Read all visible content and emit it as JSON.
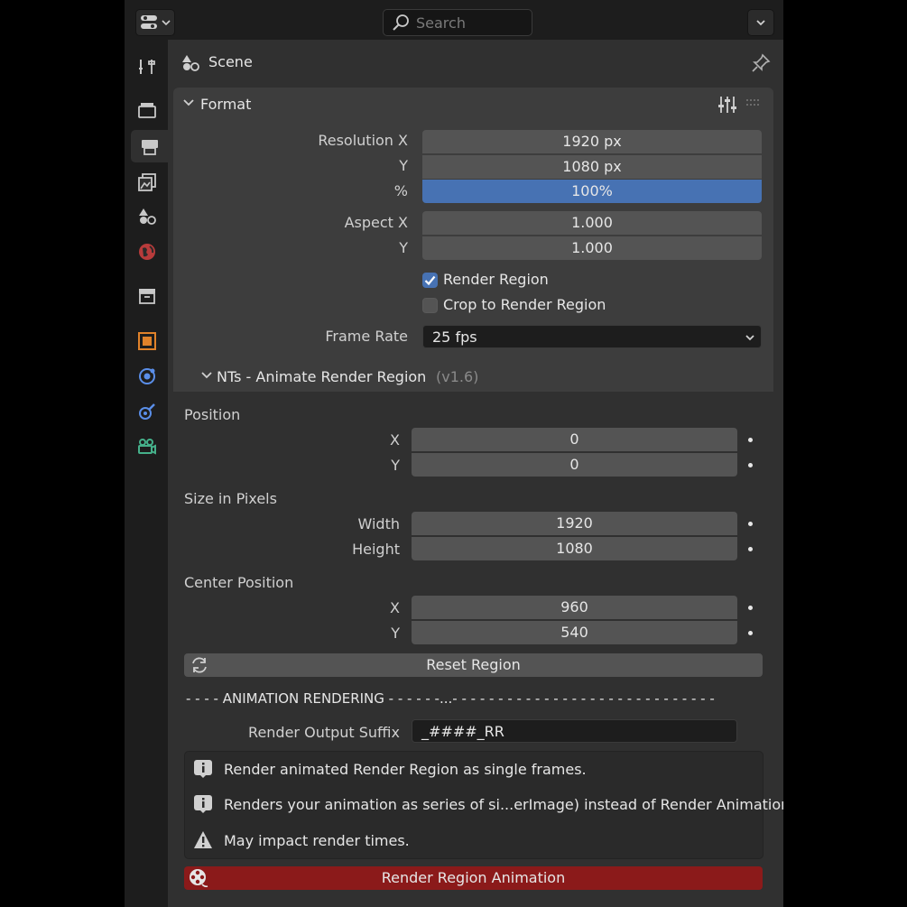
{
  "search": {
    "placeholder": "Search"
  },
  "header": {
    "title": "Scene"
  },
  "tabs": [
    "tool",
    "render",
    "output",
    "view-layer",
    "scene",
    "world",
    "collection",
    "object",
    "physics",
    "constraints",
    "data"
  ],
  "format": {
    "title": "Format",
    "resolution_x_label": "Resolution X",
    "resolution_x": "1920 px",
    "resolution_y_label": "Y",
    "resolution_y": "1080 px",
    "percent_label": "%",
    "percent": "100%",
    "aspect_x_label": "Aspect X",
    "aspect_x": "1.000",
    "aspect_y_label": "Y",
    "aspect_y": "1.000",
    "render_region_label": "Render Region",
    "render_region_checked": true,
    "crop_label": "Crop to Render Region",
    "crop_checked": false,
    "frame_rate_label": "Frame Rate",
    "frame_rate": "25 fps"
  },
  "addon": {
    "title": "NTs - Animate Render Region",
    "version": "(v1.6)",
    "position_label": "Position",
    "pos_x_label": "X",
    "pos_x": "0",
    "pos_y_label": "Y",
    "pos_y": "0",
    "size_label": "Size in Pixels",
    "width_label": "Width",
    "width": "1920",
    "height_label": "Height",
    "height": "1080",
    "center_label": "Center Position",
    "center_x_label": "X",
    "center_x": "960",
    "center_y_label": "Y",
    "center_y": "540",
    "reset_label": "Reset Region",
    "divider": "- - - -  ANIMATION RENDERING  - - - - - -...- - - - - - - - - - - - - - - - - - - - - - - - - - - - -",
    "suffix_label": "Render Output Suffix",
    "suffix_value": "_####_RR",
    "info_1": "Render animated Render Region as single frames.",
    "info_2": "Renders your animation as series of si...erImage) instead of Render Animation.",
    "info_3": "May impact render times.",
    "render_button": "Render Region Animation"
  },
  "colors": {
    "accent": "#4772b3",
    "render_button": "#8b1a1a",
    "panel": "#3d3d3d",
    "background": "#303030"
  }
}
